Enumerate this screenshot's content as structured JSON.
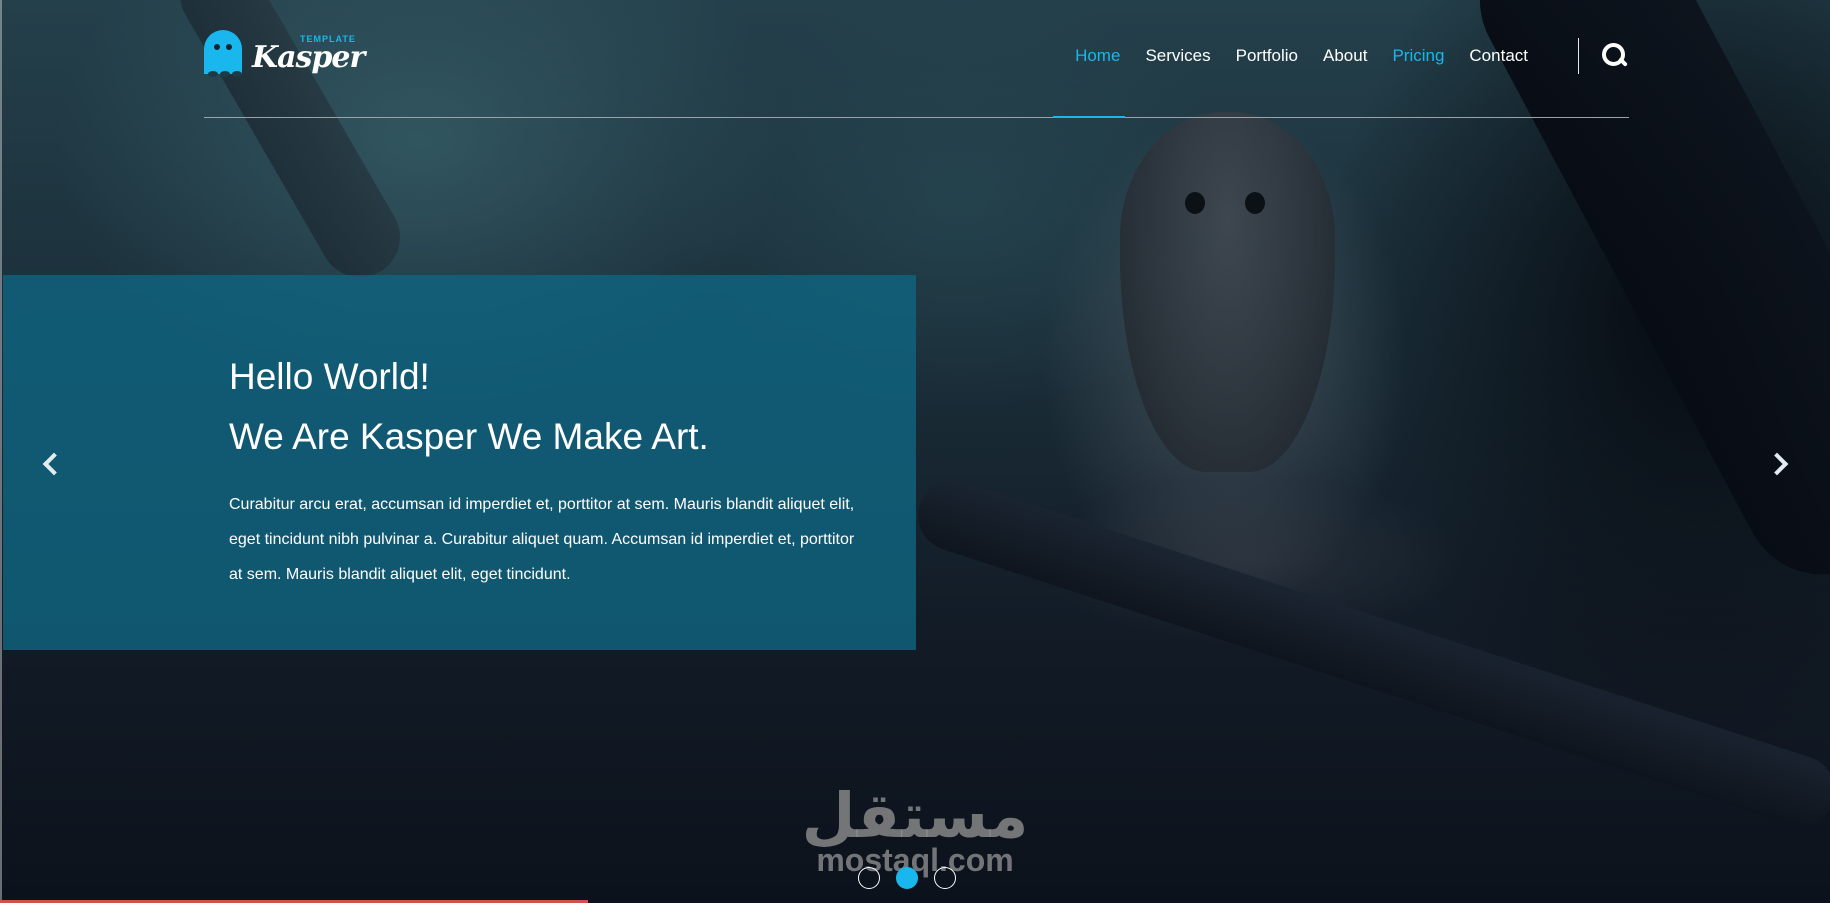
{
  "brand": {
    "name": "Kasper",
    "tagline": "TEMPLATE",
    "accent_color": "#1ab6ee"
  },
  "nav": {
    "items": [
      {
        "label": "Home",
        "active": true
      },
      {
        "label": "Services",
        "active": false
      },
      {
        "label": "Portfolio",
        "active": false
      },
      {
        "label": "About",
        "active": false
      },
      {
        "label": "Pricing",
        "active": true
      },
      {
        "label": "Contact",
        "active": false
      }
    ],
    "search_icon": "search-icon"
  },
  "hero": {
    "title_line1": "Hello World!",
    "title_line2": "We Are Kasper We Make Art.",
    "body": "Curabitur arcu erat, accumsan id imperdiet et, porttitor at sem. Mauris blandit aliquet elit, eget tincidunt nibh pulvinar a. Curabitur aliquet quam. Accumsan id imperdiet et, porttitor at sem. Mauris blandit aliquet elit, eget tincidunt.",
    "panel_color": "#106480"
  },
  "slider": {
    "prev_icon": "chevron-left-icon",
    "next_icon": "chevron-right-icon",
    "total_slides": 3,
    "active_slide": 2
  },
  "watermark": {
    "arabic": "مستقل",
    "latin": "mostaql.com"
  }
}
